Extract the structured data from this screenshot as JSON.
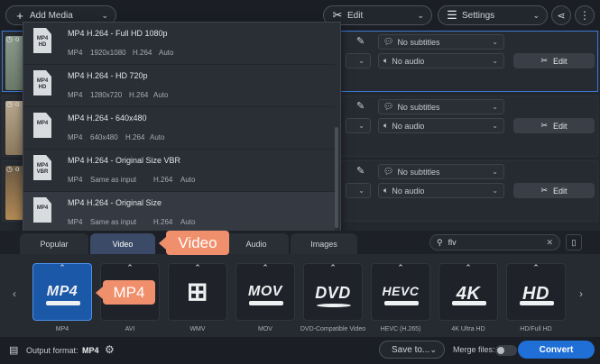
{
  "toolbar": {
    "add_media_label": "Add Media",
    "edit_label": "Edit",
    "settings_label": "Settings"
  },
  "rows": [
    {
      "subtitles": "No subtitles",
      "audio": "No audio",
      "edit_label": "Edit",
      "prefix": "o"
    },
    {
      "subtitles": "No subtitles",
      "audio": "No audio",
      "edit_label": "Edit",
      "prefix": "o"
    },
    {
      "subtitles": "No subtitles",
      "audio": "No audio",
      "edit_label": "Edit",
      "prefix": "o"
    }
  ],
  "preset_menu": [
    {
      "title": "MP4 H.264 - Full HD 1080p",
      "container": "MP4",
      "resolution": "1920x1080",
      "codec": "H.264",
      "bitrate": "Auto",
      "badge": "MP4 HD"
    },
    {
      "title": "MP4 H.264 - HD 720p",
      "container": "MP4",
      "resolution": "1280x720",
      "codec": "H.264",
      "bitrate": "Auto",
      "badge": "MP4 HD"
    },
    {
      "title": "MP4 H.264 - 640x480",
      "container": "MP4",
      "resolution": "640x480",
      "codec": "H.264",
      "bitrate": "Auto",
      "badge": "MP4"
    },
    {
      "title": "MP4 H.264 - Original Size VBR",
      "container": "MP4",
      "resolution": "Same as input",
      "codec": "H.264",
      "bitrate": "Auto",
      "badge": "MP4 VBR"
    },
    {
      "title": "MP4 H.264 - Original Size",
      "container": "MP4",
      "resolution": "Same as input",
      "codec": "H.264",
      "bitrate": "Auto",
      "badge": "MP4"
    }
  ],
  "tabs": [
    "Popular",
    "Video",
    "Audio",
    "Images"
  ],
  "search": {
    "value": "flv"
  },
  "formats": [
    {
      "logo": "MP4",
      "label": "MP4"
    },
    {
      "logo": "AVI",
      "label": "AVI"
    },
    {
      "logo": "",
      "label": "WMV"
    },
    {
      "logo": "MOV",
      "label": "MOV"
    },
    {
      "logo": "DVD",
      "label": "DVD-Compatible Video"
    },
    {
      "logo": "HEVC",
      "label": "HEVC (H.265)"
    },
    {
      "logo": "4K",
      "label": "4K Ultra HD"
    },
    {
      "logo": "HD",
      "label": "HD/Full HD"
    }
  ],
  "callouts": {
    "video": "Video",
    "mp4": "MP4"
  },
  "bottom": {
    "output_format_label": "Output format:",
    "output_format_value": "MP4",
    "save_to_label": "Save to...",
    "merge_label": "Merge files:",
    "convert_label": "Convert"
  },
  "colors": {
    "accent": "#1f6fd6",
    "callout": "#f08f6b",
    "selected_border": "#3a7bd5"
  }
}
